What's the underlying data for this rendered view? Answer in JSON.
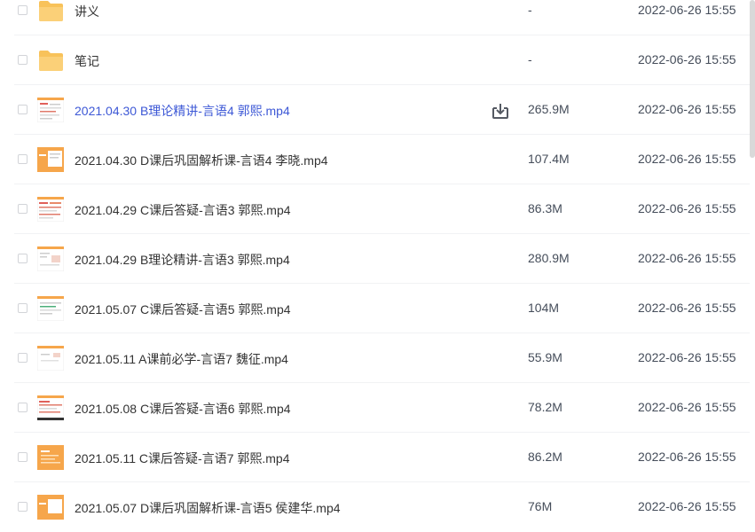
{
  "files": [
    {
      "type": "folder",
      "name": "讲义",
      "size": "-",
      "date": "2022-06-26 15:55"
    },
    {
      "type": "folder",
      "name": "笔记",
      "size": "-",
      "date": "2022-06-26 15:55"
    },
    {
      "type": "video",
      "name": "2021.04.30 B理论精讲-言语4 郭熙.mp4",
      "size": "265.9M",
      "date": "2022-06-26 15:55"
    },
    {
      "type": "video",
      "name": "2021.04.30 D课后巩固解析课-言语4 李晓.mp4",
      "size": "107.4M",
      "date": "2022-06-26 15:55"
    },
    {
      "type": "video",
      "name": "2021.04.29 C课后答疑-言语3 郭熙.mp4",
      "size": "86.3M",
      "date": "2022-06-26 15:55"
    },
    {
      "type": "video",
      "name": "2021.04.29 B理论精讲-言语3 郭熙.mp4",
      "size": "280.9M",
      "date": "2022-06-26 15:55"
    },
    {
      "type": "video",
      "name": "2021.05.07 C课后答疑-言语5 郭熙.mp4",
      "size": "104M",
      "date": "2022-06-26 15:55"
    },
    {
      "type": "video",
      "name": "2021.05.11 A课前必学-言语7 魏征.mp4",
      "size": "55.9M",
      "date": "2022-06-26 15:55"
    },
    {
      "type": "video",
      "name": "2021.05.08 C课后答疑-言语6 郭熙.mp4",
      "size": "78.2M",
      "date": "2022-06-26 15:55"
    },
    {
      "type": "video",
      "name": "2021.05.11 C课后答疑-言语7 郭熙.mp4",
      "size": "86.2M",
      "date": "2022-06-26 15:55"
    },
    {
      "type": "video",
      "name": "2021.05.07 D课后巩固解析课-言语5 侯建华.mp4",
      "size": "76M",
      "date": "2022-06-26 15:55"
    }
  ],
  "colors": {
    "folder": "#f8c25a",
    "active_name": "#3d58d6",
    "text": "#333333",
    "meta_text": "#454d5a",
    "thumb_orange": "#f6a64b"
  },
  "icons": {
    "folder": "folder-icon",
    "video": "video-thumbnail",
    "download": "download-icon"
  }
}
